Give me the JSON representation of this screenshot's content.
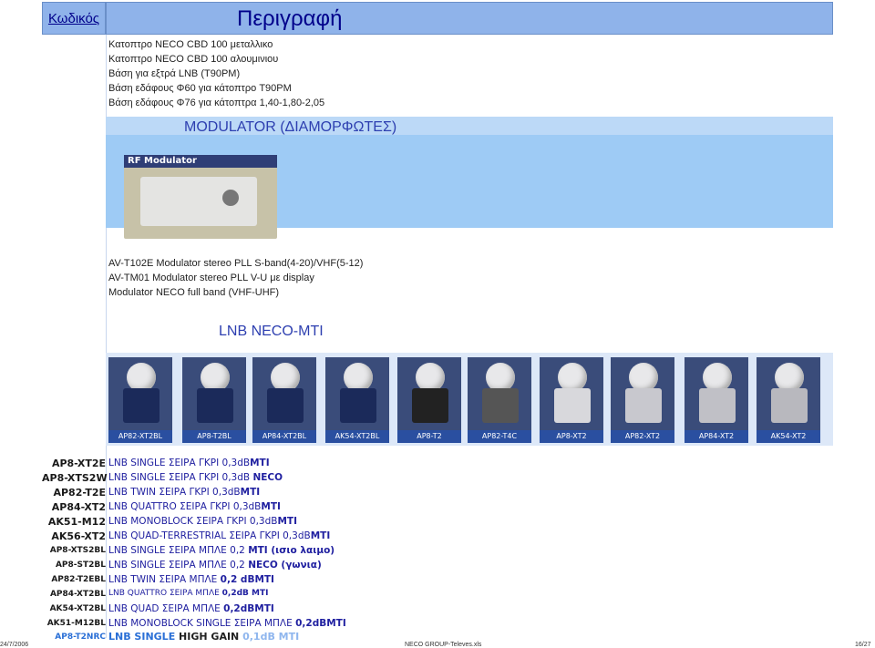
{
  "header": {
    "code_label": "Κωδικός",
    "desc_label": "Περιγραφή"
  },
  "top_items": [
    "Κατοπτρο NECO CBD 100 μεταλλικο",
    "Κατοπτρο NECO CBD 100 αλουμινιου",
    "Βάση για εξτρά LNB (T90PM)",
    "Βάση εδάφους  Φ60 για κάτοπτρο T90PM",
    "Βάση εδάφους  Φ76 για κάτοπτρα 1,40-1,80-2,05"
  ],
  "modulator": {
    "title": "MODULATOR (ΔΙΑΜΟΡΦΩΤΕΣ)",
    "image_label": "RF Modulator",
    "items": [
      "AV-T102E Modulator stereo PLL  S-band(4-20)/VHF(5-12)",
      "AV-TM01 Modulator stereo PLL  V-U με display",
      "Modulator NECO full band (VHF-UHF)"
    ]
  },
  "lnb": {
    "title": "LNB NECO-MTI",
    "photos": [
      "AP82-XT2BL",
      "AP8-T2BL",
      "AP84-XT2BL",
      "AK54-XT2BL",
      "AP8-T2",
      "AP82-T4C",
      "AP8-XT2",
      "AP82-XT2",
      "AP84-XT2",
      "AK54-XT2"
    ]
  },
  "products": [
    {
      "code": "AP8-XT2E",
      "desc": "LNB SINGLE ΣΕΙΡΑ ΓΚΡΙ 0,3dB",
      "suffix": "MTI"
    },
    {
      "code": "AP8-XTS2W",
      "desc": "LNB SINGLE ΣΕΙΡΑ ΓΚΡΙ 0,3dB ",
      "suffix": "NECO"
    },
    {
      "code": "AP82-T2E",
      "desc": "LNB TWIN ΣΕΙΡΑ ΓΚΡΙ 0,3dB",
      "suffix": "MTI"
    },
    {
      "code": "AP84-XT2",
      "desc": "LNB QUATTRO ΣΕΙΡΑ ΓΚΡΙ 0,3dB",
      "suffix": "MTI"
    },
    {
      "code": "AK51-M12",
      "desc": "LNB MONOBLOCK ΣΕΙΡΑ ΓΚΡΙ 0,3dB",
      "suffix": "MTI"
    },
    {
      "code": "AK56-XT2",
      "desc": "LNB QUAD-TERRESTRIAL ΣΕΙΡΑ ΓΚΡΙ 0,3dB",
      "suffix": "MTI"
    },
    {
      "code": "AP8-XTS2BL",
      "desc": "LNB SINGLE ΣΕΙΡΑ ΜΠΛΕ 0,2 ",
      "suffix": "MTI (ισιο λαιμο)"
    },
    {
      "code": "AP8-ST2BL",
      "desc": "LNB SINGLE ΣΕΙΡΑ ΜΠΛΕ 0,2 ",
      "suffix": "NECO (γωνια)"
    },
    {
      "code": "AP82-T2EBL",
      "desc": "LNB TWIN ΣΕΙΡΑ ΜΠΛΕ ",
      "suffix": "0,2 dBMTI"
    },
    {
      "code": "AP84-XT2BL",
      "desc": "LNB QUATTRO ΣΕΙΡΑ ΜΠΛΕ ",
      "suffix": "0,2dB MTI"
    },
    {
      "code": "AK54-XT2BL",
      "desc": "LNB QUAD ΣΕΙΡΑ ΜΠΛΕ ",
      "suffix": "0,2dBMTI"
    },
    {
      "code": "AK51-M12BL",
      "desc": "LNB MONOBLOCK SINGLE ΣΕΙΡΑ ΜΠΛΕ ",
      "suffix": "0,2dBMTI"
    },
    {
      "code": "AP8-T2NRC",
      "desc": "LNB SINGLE ",
      "suffix": "HIGH GAIN",
      "tail": " 0,1dB MTI"
    }
  ],
  "footer": {
    "date": "24/7/2006",
    "file": "NECO GROUP-Televes.xls",
    "page": "16/27"
  }
}
